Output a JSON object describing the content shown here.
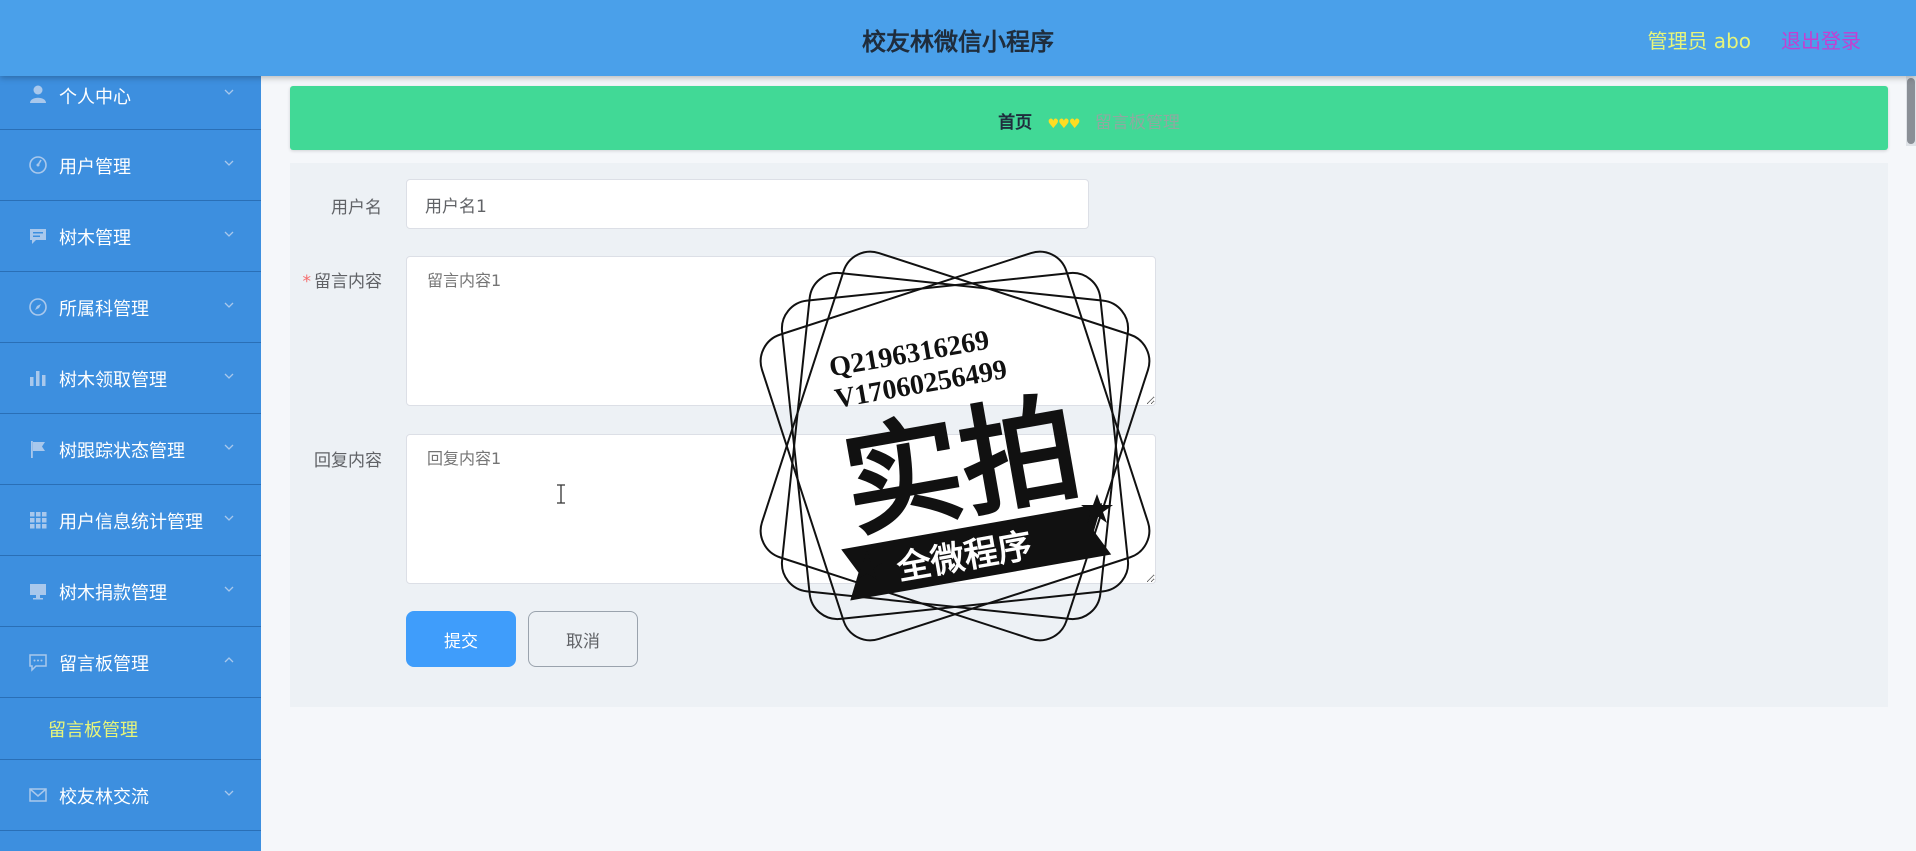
{
  "header": {
    "title": "校友林微信小程序",
    "admin_label": "管理员 abo",
    "logout_label": "退出登录"
  },
  "sidebar": {
    "items": [
      {
        "label": "个人中心",
        "icon": "person-icon"
      },
      {
        "label": "用户管理",
        "icon": "gauge-icon"
      },
      {
        "label": "树木管理",
        "icon": "chat-bubble-icon"
      },
      {
        "label": "所属科管理",
        "icon": "compass-icon"
      },
      {
        "label": "树木领取管理",
        "icon": "bar-chart-icon"
      },
      {
        "label": "树跟踪状态管理",
        "icon": "flag-icon"
      },
      {
        "label": "用户信息统计管理",
        "icon": "grid-icon"
      },
      {
        "label": "树木捐款管理",
        "icon": "monitor-icon"
      },
      {
        "label": "留言板管理",
        "icon": "message-icon"
      },
      {
        "label": "校友林交流",
        "icon": "mail-icon"
      }
    ],
    "submenu_label": "留言板管理"
  },
  "breadcrumb": {
    "home": "首页",
    "separator": "♥♥♥",
    "current": "留言板管理"
  },
  "form": {
    "username_label": "用户名",
    "username_value": "用户名1",
    "message_label": "留言内容",
    "message_required": "*",
    "message_value": "留言内容1",
    "reply_label": "回复内容",
    "reply_value": "回复内容1",
    "submit_label": "提交",
    "cancel_label": "取消"
  },
  "watermark": {
    "contact_q": "Q2196316269",
    "contact_v": "V17060256499",
    "main": "实拍",
    "banner": "全微程序"
  },
  "colors": {
    "header_bg": "#4aa0ea",
    "sidebar_bg": "#3d8fdf",
    "breadcrumb_bg": "#41d996",
    "admin_text": "#e7f57a",
    "logout_text": "#c33fd1",
    "submit_bg": "#3f9dfb"
  }
}
